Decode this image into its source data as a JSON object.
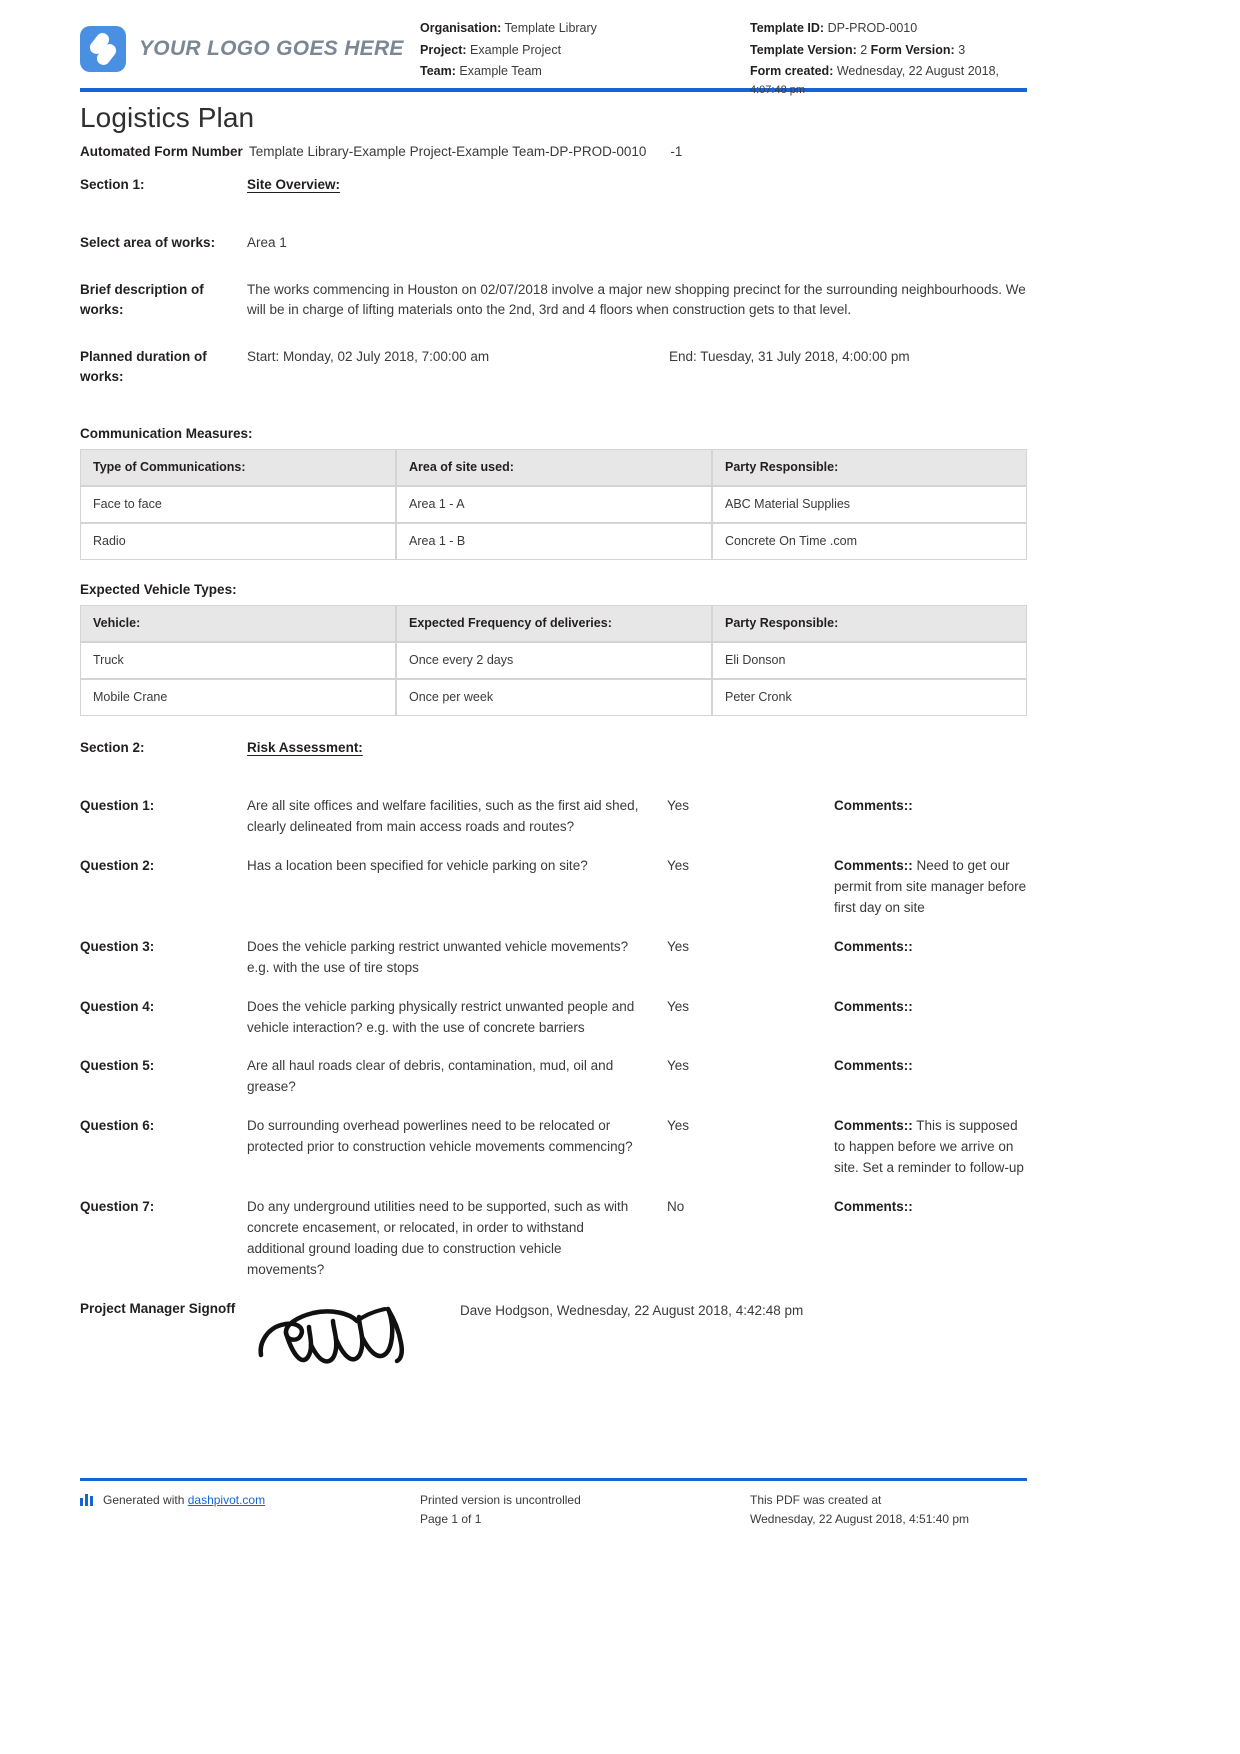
{
  "header": {
    "logo_text": "YOUR LOGO GOES HERE",
    "left_meta": {
      "organisation_label": "Organisation:",
      "organisation_value": "Template Library",
      "project_label": "Project:",
      "project_value": "Example Project",
      "team_label": "Team:",
      "team_value": "Example Team"
    },
    "right_meta": {
      "template_id_label": "Template ID:",
      "template_id_value": "DP-PROD-0010",
      "template_version_label": "Template Version:",
      "template_version_value": "2",
      "form_version_label": "Form Version:",
      "form_version_value": "3",
      "form_created_label": "Form created:",
      "form_created_value": "Wednesday, 22 August 2018,",
      "form_created_time": "4:07:48 pm"
    }
  },
  "title": "Logistics Plan",
  "fields": {
    "automated_form_number_label": "Automated Form Number",
    "automated_form_number_value": "Template Library-Example Project-Example Team-DP-PROD-0010",
    "automated_form_number_suffix": "-1",
    "section1_label": "Section 1:",
    "section1_value": "Site Overview:",
    "area_label": "Select area of works:",
    "area_value": "Area 1",
    "description_label": "Brief description of works:",
    "description_value": "The works commencing in Houston on 02/07/2018 involve a major new shopping precinct for the surrounding neighbourhoods. We will be in charge of lifting materials onto the 2nd, 3rd and 4 floors when construction gets to that level.",
    "duration_label": "Planned duration of works:",
    "duration_start": "Start: Monday, 02 July 2018, 7:00:00 am",
    "duration_end": "End: Tuesday, 31 July 2018, 4:00:00 pm"
  },
  "communication_table": {
    "caption": "Communication Measures:",
    "columns": [
      "Type of Communications:",
      "Area of site used:",
      "Party Responsible:"
    ],
    "rows": [
      [
        "Face to face",
        "Area 1 - A",
        "ABC Material Supplies"
      ],
      [
        "Radio",
        "Area 1 - B",
        "Concrete On Time .com"
      ]
    ]
  },
  "vehicle_table": {
    "caption": "Expected Vehicle Types:",
    "columns": [
      "Vehicle:",
      "Expected Frequency of deliveries:",
      "Party Responsible:"
    ],
    "rows": [
      [
        "Truck",
        "Once every 2 days",
        "Eli Donson"
      ],
      [
        "Mobile Crane",
        "Once per week",
        "Peter Cronk"
      ]
    ]
  },
  "section2": {
    "label": "Section 2:",
    "value": "Risk Assessment:",
    "comments_label": "Comments::",
    "questions": [
      {
        "label": "Question 1:",
        "text": "Are all site offices and welfare facilities, such as the first aid shed, clearly delineated from main access roads and routes?",
        "answer": "Yes",
        "comment": ""
      },
      {
        "label": "Question 2:",
        "text": "Has a location been specified for vehicle parking on site?",
        "answer": "Yes",
        "comment": " Need to get our permit from site manager before first day on site"
      },
      {
        "label": "Question 3:",
        "text": "Does the vehicle parking restrict unwanted vehicle movements? e.g. with the use of tire stops",
        "answer": "Yes",
        "comment": ""
      },
      {
        "label": "Question 4:",
        "text": "Does the vehicle parking physically restrict unwanted people and vehicle interaction? e.g. with the use of concrete barriers",
        "answer": "Yes",
        "comment": ""
      },
      {
        "label": "Question 5:",
        "text": "Are all haul roads clear of debris, contamination, mud, oil and grease?",
        "answer": "Yes",
        "comment": ""
      },
      {
        "label": "Question 6:",
        "text": "Do surrounding overhead powerlines need to be relocated or protected prior to construction vehicle movements commencing?",
        "answer": "Yes",
        "comment": " This is supposed to happen before we arrive on site. Set a reminder to follow-up"
      },
      {
        "label": "Question 7:",
        "text": "Do any underground utilities need to be supported, such as with concrete encasement, or relocated, in order to withstand additional ground loading due to construction vehicle movements?",
        "answer": "No",
        "comment": ""
      }
    ]
  },
  "signoff": {
    "label": "Project Manager Signoff",
    "name_date": "Dave Hodgson, Wednesday, 22 August 2018, 4:42:48 pm"
  },
  "footer": {
    "generated_prefix": "Generated with ",
    "generated_link": "dashpivot.com",
    "printed_line1": "Printed version is uncontrolled",
    "printed_line2": "Page 1 of 1",
    "created_line1": "This PDF was created at",
    "created_line2": "Wednesday, 22 August 2018, 4:51:40 pm"
  },
  "colors": {
    "accent_blue": "#1565d8",
    "logo_blue": "#4a90e2",
    "table_header_bg": "#e7e7e7"
  }
}
